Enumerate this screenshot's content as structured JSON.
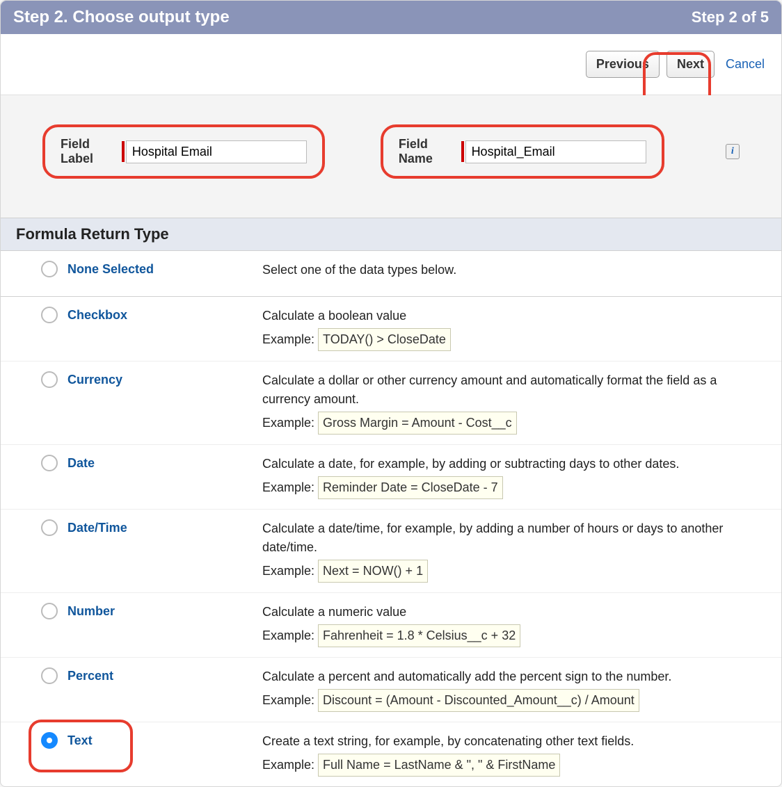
{
  "header": {
    "title": "Step 2. Choose output type",
    "progress": "Step 2 of 5"
  },
  "buttons": {
    "previous": "Previous",
    "next": "Next",
    "cancel": "Cancel"
  },
  "fields": {
    "label_caption": "Field Label",
    "label_value": "Hospital Email",
    "name_caption": "Field Name",
    "name_value": "Hospital_Email",
    "info_glyph": "i"
  },
  "section": {
    "title": "Formula Return Type"
  },
  "examplePrefix": "Example:",
  "types": [
    {
      "label": "None Selected",
      "desc": "Select one of the data types below.",
      "example": null,
      "selected": false
    },
    {
      "label": "Checkbox",
      "desc": "Calculate a boolean value",
      "example": "TODAY() > CloseDate",
      "selected": false
    },
    {
      "label": "Currency",
      "desc": "Calculate a dollar or other currency amount and automatically format the field as a currency amount.",
      "example": "Gross Margin = Amount - Cost__c",
      "selected": false
    },
    {
      "label": "Date",
      "desc": "Calculate a date, for example, by adding or subtracting days to other dates.",
      "example": "Reminder Date = CloseDate - 7",
      "selected": false
    },
    {
      "label": "Date/Time",
      "desc": "Calculate a date/time, for example, by adding a number of hours or days to another date/time.",
      "example": "Next = NOW() + 1",
      "selected": false
    },
    {
      "label": "Number",
      "desc": "Calculate a numeric value",
      "example": "Fahrenheit = 1.8 * Celsius__c + 32",
      "selected": false
    },
    {
      "label": "Percent",
      "desc": "Calculate a percent and automatically add the percent sign to the number.",
      "example": "Discount = (Amount - Discounted_Amount__c) / Amount",
      "selected": false
    },
    {
      "label": "Text",
      "desc": "Create a text string, for example, by concatenating other text fields.",
      "example": "Full Name = LastName & \", \" & FirstName",
      "selected": true
    }
  ]
}
